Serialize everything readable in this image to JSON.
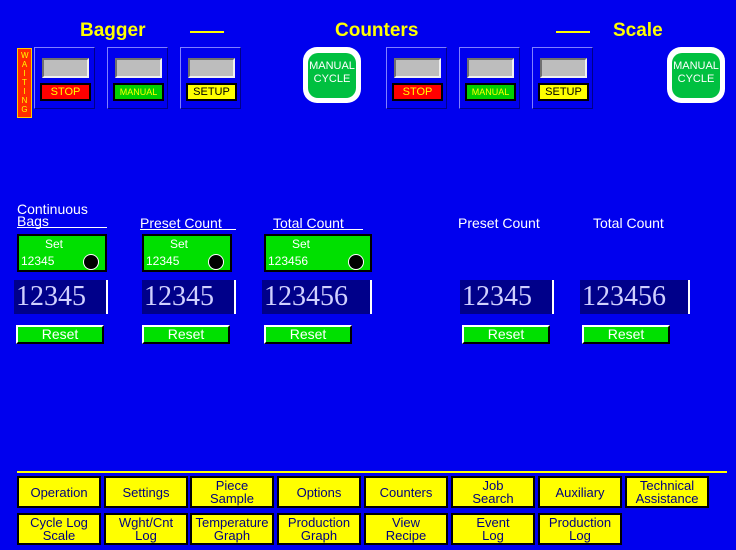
{
  "header": {
    "bagger_title": "Bagger",
    "counters_title": "Counters",
    "scale_title": "Scale"
  },
  "status": {
    "waiting": "WAITING"
  },
  "bagger_controls": {
    "stop_label": "STOP",
    "manual_label": "MANUAL",
    "setup_label": "SETUP",
    "manual_cycle_line1": "MANUAL",
    "manual_cycle_line2": "CYCLE"
  },
  "scale_controls": {
    "stop_label": "STOP",
    "manual_label": "MANUAL",
    "setup_label": "SETUP",
    "manual_cycle_line1": "MANUAL",
    "manual_cycle_line2": "CYCLE"
  },
  "counters": {
    "continuous_bags_line1": "Continuous",
    "continuous_bags_line2": "Bags",
    "preset_count": "Preset Count",
    "total_count": "Total Count",
    "set_label": "Set",
    "continuous_set_value": "12345",
    "preset_set_value": "12345",
    "total_set_value": "123456",
    "continuous_value": "12345",
    "preset_value": "12345",
    "total_value": "123456",
    "reset_label": "Reset"
  },
  "scale_counters": {
    "preset_count": "Preset Count",
    "total_count": "Total Count",
    "preset_value": "12345",
    "total_value": "123456",
    "reset_label": "Reset"
  },
  "nav": {
    "row1": [
      {
        "l1": "Operation",
        "l2": ""
      },
      {
        "l1": "Settings",
        "l2": ""
      },
      {
        "l1": "Piece",
        "l2": "Sample"
      },
      {
        "l1": "Options",
        "l2": ""
      },
      {
        "l1": "Counters",
        "l2": ""
      },
      {
        "l1": "Job",
        "l2": "Search"
      },
      {
        "l1": "Auxiliary",
        "l2": ""
      },
      {
        "l1": "Technical",
        "l2": "Assistance"
      }
    ],
    "row2": [
      {
        "l1": "Cycle Log",
        "l2": "Scale"
      },
      {
        "l1": "Wght/Cnt",
        "l2": "Log"
      },
      {
        "l1": "Temperature",
        "l2": "Graph"
      },
      {
        "l1": "Production",
        "l2": "Graph"
      },
      {
        "l1": "View",
        "l2": "Recipe"
      },
      {
        "l1": "Event",
        "l2": "Log"
      },
      {
        "l1": "Production",
        "l2": "Log"
      }
    ]
  },
  "colors": {
    "background": "#0000ee",
    "accent": "#ffff00",
    "green": "#00e000",
    "red": "#ff0000"
  }
}
